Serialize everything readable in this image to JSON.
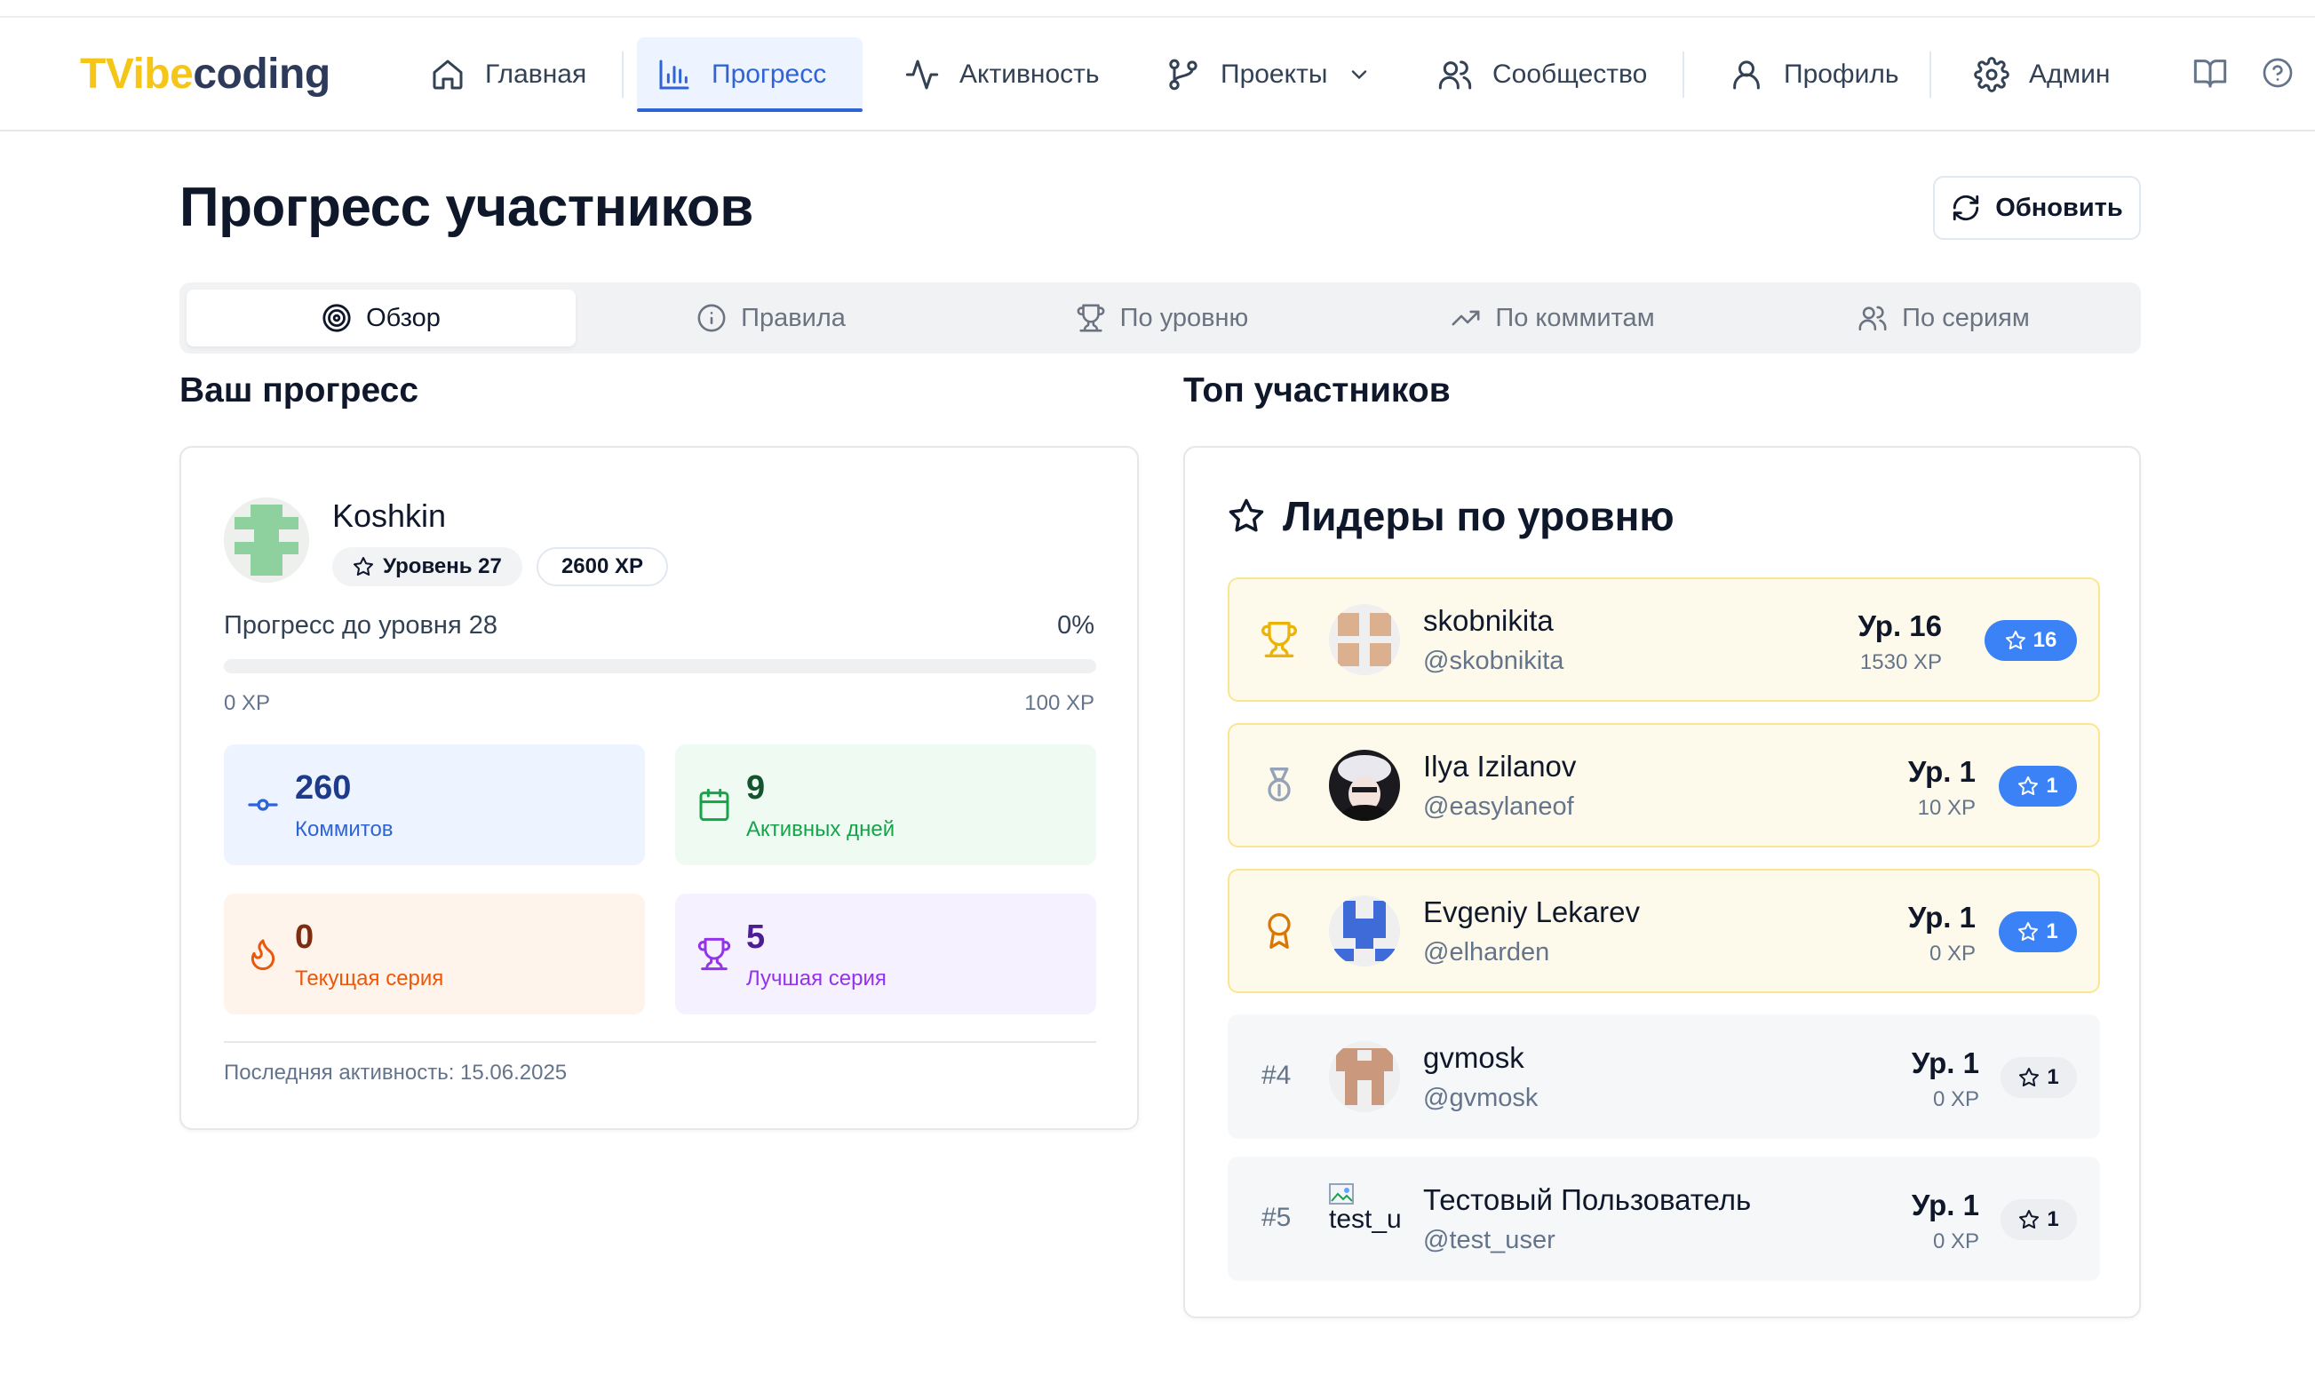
{
  "app": {
    "logo_a": "TVibe",
    "logo_b": "coding"
  },
  "nav": {
    "home": "Главная",
    "progress": "Прогресс",
    "activity": "Активность",
    "projects": "Проекты",
    "community": "Сообщество",
    "profile": "Профиль",
    "admin": "Админ"
  },
  "page": {
    "title": "Прогресс участников",
    "refresh": "Обновить"
  },
  "tabs": {
    "overview": "Обзор",
    "rules": "Правила",
    "by_level": "По уровню",
    "by_commits": "По коммитам",
    "by_streaks": "По сериям"
  },
  "your_progress": {
    "section_title": "Ваш прогресс",
    "name": "Koshkin",
    "level_badge": "Уровень 27",
    "xp_badge": "2600 XP",
    "progress_label": "Прогресс до уровня 28",
    "progress_percent": "0%",
    "progress_value": 0,
    "xp_min": "0 XP",
    "xp_max": "100 XP",
    "stats": {
      "commits": {
        "value": "260",
        "label": "Коммитов"
      },
      "active_days": {
        "value": "9",
        "label": "Активных дней"
      },
      "current_streak": {
        "value": "0",
        "label": "Текущая серия"
      },
      "best_streak": {
        "value": "5",
        "label": "Лучшая серия"
      }
    },
    "last_activity": "Последняя активность: 15.06.2025"
  },
  "top": {
    "section_title": "Топ участников",
    "card_title": "Лидеры по уровню",
    "leaders": [
      {
        "rank": "1",
        "name": "skobnikita",
        "handle": "@skobnikita",
        "level": "Ур. 16",
        "xp": "1530 XP",
        "badge": "16"
      },
      {
        "rank": "2",
        "name": "Ilya Izilanov",
        "handle": "@easylaneof",
        "level": "Ур. 1",
        "xp": "10 XP",
        "badge": "1"
      },
      {
        "rank": "3",
        "name": "Evgeniy Lekarev",
        "handle": "@elharden",
        "level": "Ур. 1",
        "xp": "0 XP",
        "badge": "1"
      },
      {
        "rank": "#4",
        "name": "gvmosk",
        "handle": "@gvmosk",
        "level": "Ур. 1",
        "xp": "0 XP",
        "badge": "1"
      },
      {
        "rank": "#5",
        "name": "Тестовый Пользователь",
        "handle": "@test_user",
        "level": "Ур. 1",
        "xp": "0 XP",
        "badge": "1",
        "avatar_alt": "test_user"
      }
    ]
  },
  "colors": {
    "accent": "#2f63d6",
    "logo_yellow": "#f5c518",
    "logo_dark": "#2d3a5a",
    "gold_row_bg": "#fefaeb",
    "pill_blue": "#3b82f6"
  }
}
